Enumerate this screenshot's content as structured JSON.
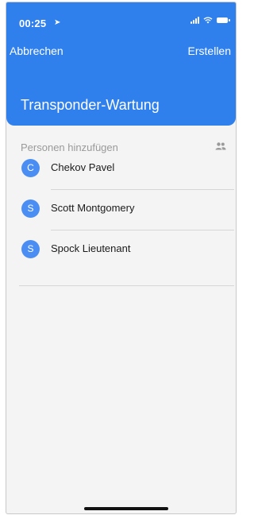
{
  "status_bar": {
    "time": "00:25"
  },
  "nav": {
    "cancel_label": "Abbrechen",
    "create_label": "Erstellen"
  },
  "title": "Transponder-Wartung",
  "section": {
    "label": "Personen hinzufügen",
    "icon": "people-icon"
  },
  "people": [
    {
      "initial": "C",
      "name": "Chekov Pavel"
    },
    {
      "initial": "S",
      "name": "Scott Montgomery"
    },
    {
      "initial": "S",
      "name": "Spock Lieutenant"
    }
  ],
  "colors": {
    "accent": "#2f80ed",
    "avatar": "#4a8ef3",
    "background": "#f4f4f4"
  }
}
